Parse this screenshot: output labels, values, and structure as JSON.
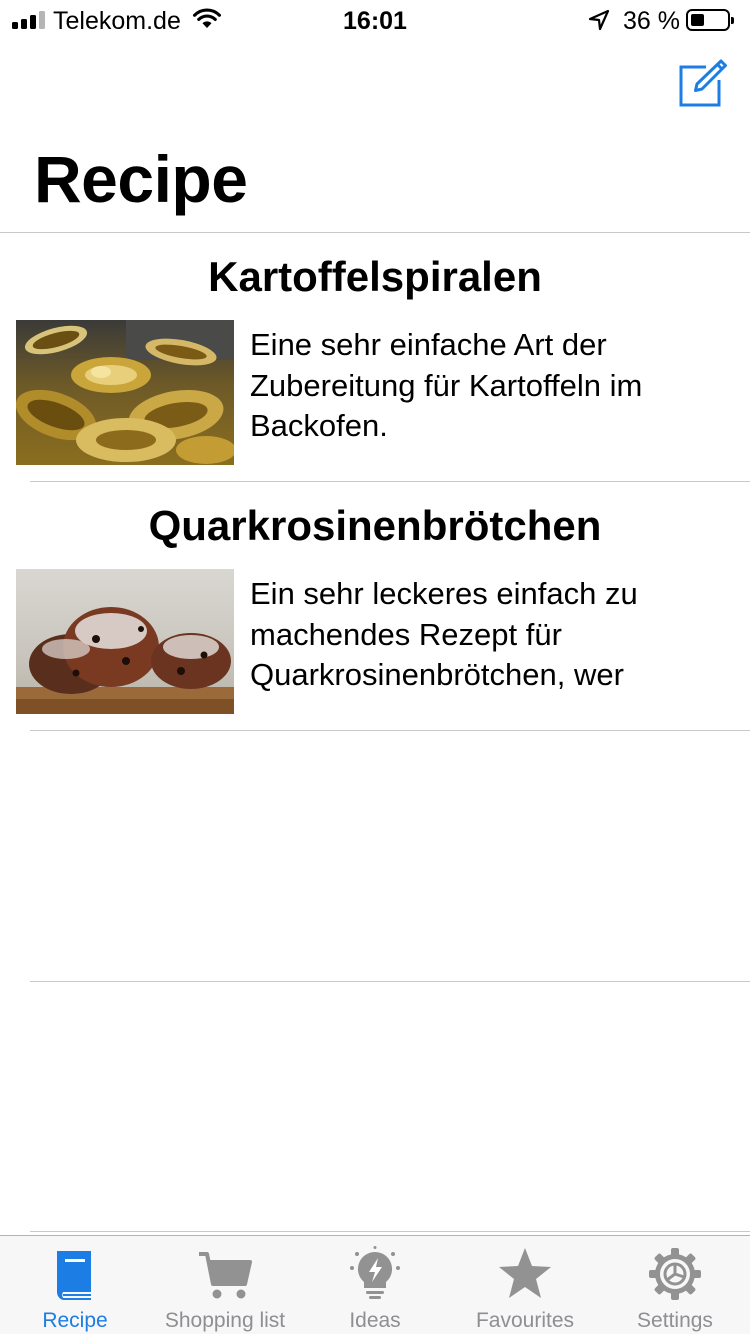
{
  "status_bar": {
    "carrier": "Telekom.de",
    "time": "16:01",
    "battery_percent": "36 %",
    "battery_level": 0.36
  },
  "header": {
    "title": "Recipe",
    "compose_icon": "compose-icon"
  },
  "recipes": [
    {
      "title": "Kartoffelspiralen",
      "description": "Eine sehr einfache Art der Zubereitung für Kartoffeln im Backofen."
    },
    {
      "title": "Quarkrosinenbrötchen",
      "description": "Ein sehr leckeres einfach zu machendes Rezept für Quarkrosinenbrötchen, wer"
    }
  ],
  "tab_bar": {
    "tabs": [
      {
        "label": "Recipe",
        "icon": "book-icon",
        "active": true
      },
      {
        "label": "Shopping list",
        "icon": "cart-icon",
        "active": false
      },
      {
        "label": "Ideas",
        "icon": "lightbulb-icon",
        "active": false
      },
      {
        "label": "Favourites",
        "icon": "star-icon",
        "active": false
      },
      {
        "label": "Settings",
        "icon": "gear-icon",
        "active": false
      }
    ]
  },
  "colors": {
    "accent": "#1c7ee4",
    "inactive": "#8e8e93",
    "separator": "#c8c7cc"
  }
}
